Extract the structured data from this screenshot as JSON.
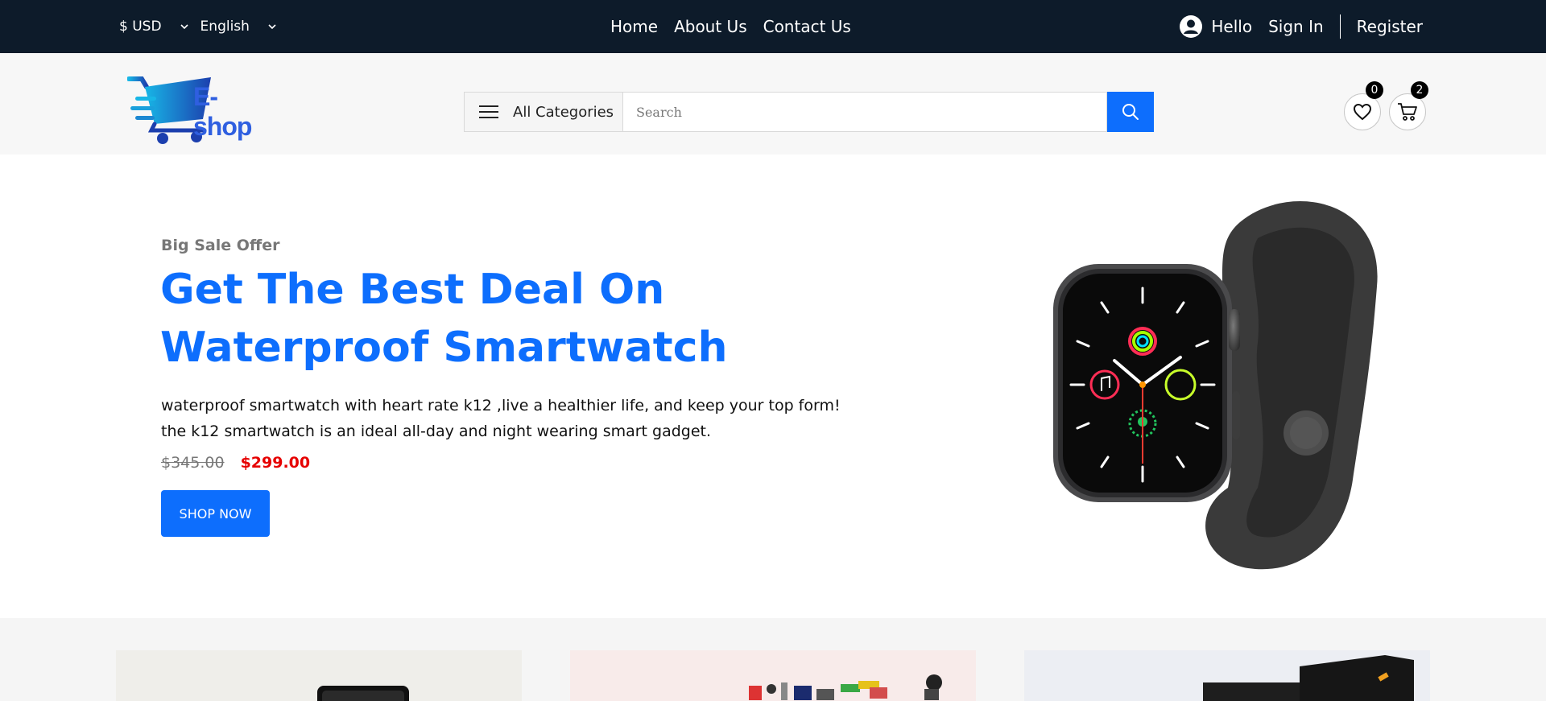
{
  "topbar": {
    "currency": "$ USD",
    "language": "English",
    "nav": [
      "Home",
      "About Us",
      "Contact Us"
    ],
    "greeting": "Hello",
    "signin": "Sign In",
    "register": "Register"
  },
  "header": {
    "logo_text": "E-shop",
    "categories_label": "All Categories",
    "search_placeholder": "Search",
    "wishlist_count": "0",
    "cart_count": "2"
  },
  "hero": {
    "kicker": "Big Sale Offer",
    "title": "Get The Best Deal On Waterproof Smartwatch",
    "description": "waterproof smartwatch with heart rate k12 ,live a healthier life, and keep your top form! the k12 smartwatch is an ideal all-day and night wearing smart gadget.",
    "old_price": "$345.00",
    "new_price": "$299.00",
    "button": "SHOP NOW"
  },
  "colors": {
    "topbar_bg": "#0d1b2a",
    "accent": "#0d6efd",
    "sale_red": "#e60000"
  },
  "icons": [
    "chevron-down-icon",
    "user-icon",
    "menu-icon",
    "search-icon",
    "heart-icon",
    "cart-icon"
  ]
}
